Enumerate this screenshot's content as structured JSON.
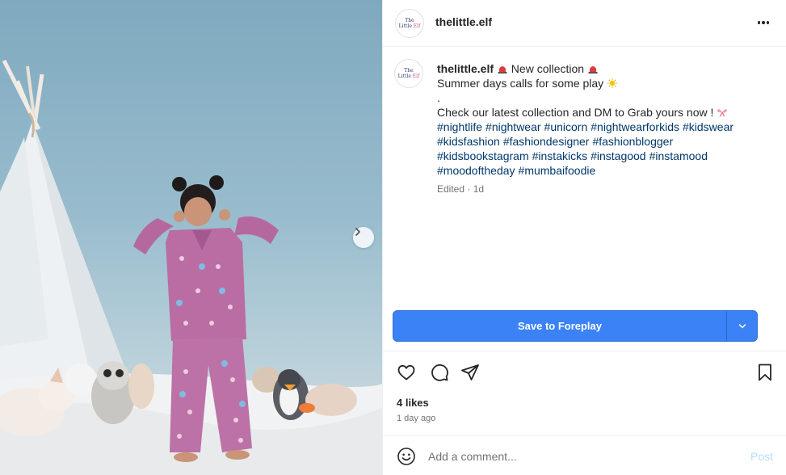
{
  "post": {
    "username": "thelittle.elf",
    "avatar": {
      "line1": "The",
      "line2a": "Little ",
      "line2b": "Elf"
    },
    "caption": {
      "line1": "New collection",
      "line2": "Summer days calls for some play",
      "line3": ".",
      "line4": "Check our latest collection and DM to Grab yours now !",
      "hashtags": [
        "#nightlife",
        "#nightwear",
        "#unicorn",
        "#nightwearforkids",
        "#kidswear",
        "#kidsfashion",
        "#fashiondesigner",
        "#fashionblogger",
        "#kidsbookstagram",
        "#instakicks",
        "#instagood",
        "#instamood",
        "#moodoftheday",
        "#mumbaifoodie"
      ]
    },
    "meta": "Edited · 1d",
    "likes": "4 likes",
    "time_ago": "1 day ago"
  },
  "save_button": {
    "label": "Save to Foreplay"
  },
  "comment": {
    "placeholder": "Add a comment...",
    "post_label": "Post"
  },
  "icons": {
    "heart": "heart-icon",
    "comment": "comment-icon",
    "share": "share-icon",
    "bookmark": "bookmark-icon",
    "more": "more-icon",
    "emoji": "emoji-icon",
    "next": "chevron-right-icon",
    "dropdown": "chevron-down-icon"
  },
  "colors": {
    "accent": "#3b82f6",
    "hashtag": "#00376b",
    "muted": "#737373",
    "post_disabled": "#b2dffc"
  }
}
